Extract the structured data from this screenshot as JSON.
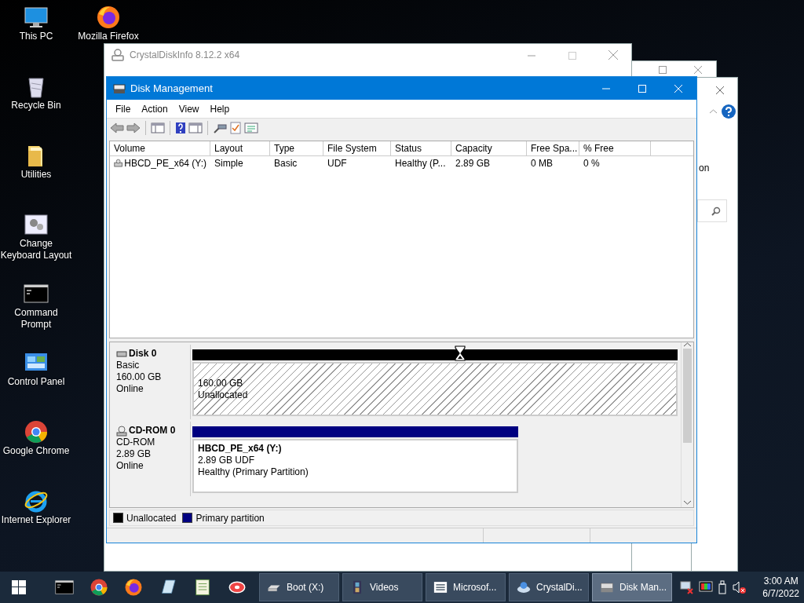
{
  "desktop_icon_columns": [
    [
      {
        "kind": "pc",
        "label": "This PC"
      },
      {
        "kind": "recycle",
        "label": "Recycle Bin"
      },
      {
        "kind": "folder",
        "label": "Utilities"
      },
      {
        "kind": "keyboard",
        "label": "Change Keyboard Layout"
      },
      {
        "kind": "terminal",
        "label": "Command Prompt"
      },
      {
        "kind": "control",
        "label": "Control Panel"
      },
      {
        "kind": "chrome",
        "label": "Google Chrome"
      },
      {
        "kind": "ie",
        "label": "Internet Explorer"
      }
    ],
    [
      {
        "kind": "firefox",
        "label": "Mozilla Firefox"
      }
    ]
  ],
  "crystaldiskinfo_window": {
    "title": "CrystalDiskInfo 8.12.2 x64"
  },
  "explorer_window": {
    "text": "on"
  },
  "disk_management": {
    "title": "Disk Management",
    "menu": [
      "File",
      "Action",
      "View",
      "Help"
    ],
    "volume_table": {
      "columns": [
        "Volume",
        "Layout",
        "Type",
        "File System",
        "Status",
        "Capacity",
        "Free Spa...",
        "% Free"
      ],
      "rows": [
        {
          "cells": [
            "HBCD_PE_x64 (Y:)",
            "Simple",
            "Basic",
            "UDF",
            "Healthy (P...",
            "2.89 GB",
            "0 MB",
            "0 %"
          ]
        }
      ]
    },
    "disks": [
      {
        "kind": "hdd",
        "name": "Disk 0",
        "type": "Basic",
        "size": "160.00 GB",
        "status": "Online",
        "partitions": [
          {
            "kind": "unallocated",
            "lines": [
              "160.00 GB",
              "Unallocated"
            ]
          }
        ]
      },
      {
        "kind": "cdrom",
        "name": "CD-ROM 0",
        "type": "CD-ROM",
        "size": "2.89 GB",
        "status": "Online",
        "partitions": [
          {
            "kind": "primary",
            "name": "HBCD_PE_x64  (Y:)",
            "lines": [
              "2.89 GB UDF",
              "Healthy (Primary Partition)"
            ]
          }
        ]
      }
    ],
    "legend": [
      {
        "label": "Unallocated",
        "color": "#000000"
      },
      {
        "label": "Primary partition",
        "color": "#000080"
      }
    ]
  },
  "taskbar": {
    "pinned": [
      {
        "kind": "terminal"
      },
      {
        "kind": "chrome"
      },
      {
        "kind": "firefox"
      },
      {
        "kind": "notepad"
      },
      {
        "kind": "sheet"
      },
      {
        "kind": "disc"
      }
    ],
    "tasks": [
      {
        "kind": "drive",
        "label": "Boot (X:)",
        "selected": false
      },
      {
        "kind": "film",
        "label": "Videos",
        "selected": false
      },
      {
        "kind": "list",
        "label": "Microsof...",
        "selected": false
      },
      {
        "kind": "crystal",
        "label": "CrystalDi...",
        "selected": false
      },
      {
        "kind": "diskmgmt",
        "label": "Disk Man...",
        "selected": true
      }
    ],
    "time": "3:00 AM",
    "date": "6/7/2022"
  }
}
